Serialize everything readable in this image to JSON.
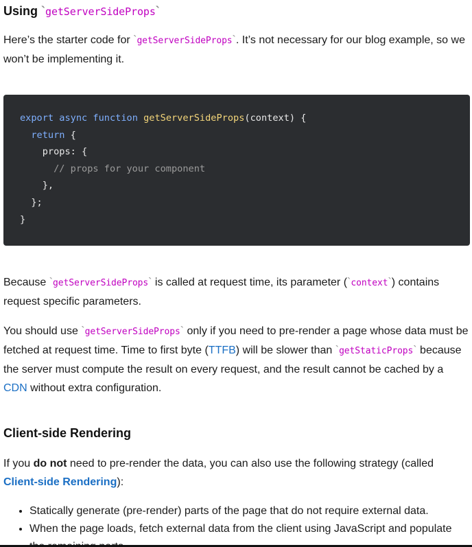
{
  "section1": {
    "heading_text": "Using ",
    "heading_code": "getServerSideProps"
  },
  "intro": {
    "before": "Here’s the starter code for ",
    "code": "getServerSideProps",
    "after": ". It’s not necessary for our blog example, so we won’t be implementing it."
  },
  "code_block": {
    "line1_kw1": "export",
    "line1_kw2": "async",
    "line1_kw3": "function",
    "line1_fn": "getServerSideProps",
    "line1_rest": "(context) {",
    "line2_kw": "return",
    "line2_rest": " {",
    "line3": "    props: {",
    "line4": "      // props for your component",
    "line5": "    },",
    "line6": "  };",
    "line7": "}"
  },
  "because": {
    "before": "Because ",
    "code": "getServerSideProps",
    "middle": " is called at request time, its parameter (",
    "param": "context",
    "after": ") contains request specific parameters."
  },
  "use": {
    "before": "You should use ",
    "code": "getServerSideProps",
    "middle1": " only if you need to pre-render a page whose data must be fetched at request time. Time to first byte (",
    "ttfb": "TTFB",
    "middle2": ") will be slower than ",
    "code2": "getStaticProps",
    "middle3": " because the server must compute the result on every request, and the result cannot be cached by a ",
    "cdn": "CDN",
    "after": " without extra configuration."
  },
  "section2": {
    "heading": "Client-side Rendering"
  },
  "ifnot": {
    "before": "If you ",
    "bold": "do not",
    "middle": " need to pre-render the data, you can also use the following strategy (called ",
    "link": "Client-side Rendering",
    "after": "):"
  },
  "bullets": [
    "Statically generate (pre-render) parts of the page that do not require external data.",
    "When the page loads, fetch external data from the client using JavaScript and populate the remaining parts."
  ],
  "colors": {
    "inline_code": "#c000c0",
    "link": "#1b6fc4",
    "code_bg": "#2b2d30"
  }
}
